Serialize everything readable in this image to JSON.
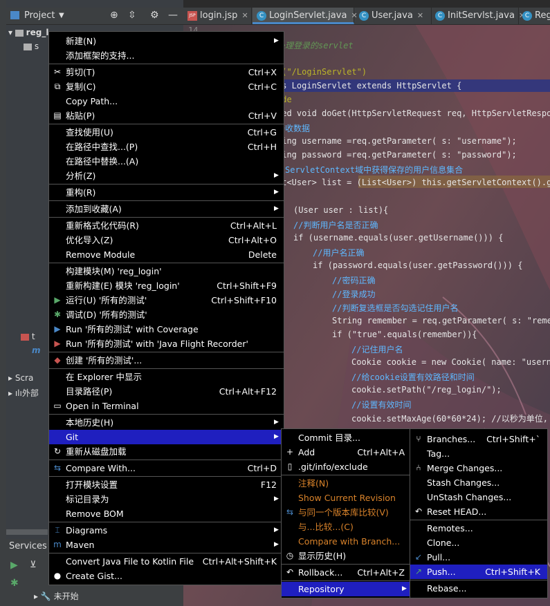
{
  "project_panel": {
    "title": "Project",
    "root_node": "reg_l",
    "tree_fragments": [
      "s",
      "t",
      "m",
      "Scra",
      "外部"
    ]
  },
  "services": {
    "label": "Services",
    "node": "未开始"
  },
  "editor": {
    "tabs": [
      {
        "label": "login.jsp",
        "icon": "jsp-file-icon"
      },
      {
        "label": "LoginServlet.java",
        "icon": "class-icon"
      },
      {
        "label": "User.java",
        "icon": "class-icon"
      },
      {
        "label": "InitServlst.java",
        "icon": "class-icon"
      },
      {
        "label": "Reg",
        "icon": "class-icon"
      }
    ],
    "line_number": "14",
    "lines": [
      {
        "t": "处理登录的servlet",
        "c": "cm"
      },
      {
        "t": "t(\"/LoginServlet\")",
        "c": "ann"
      },
      {
        "t": "ss LoginServlet extends HttpServlet {",
        "c": "plain"
      },
      {
        "t": "ide",
        "c": "ann"
      },
      {
        "t": "ted void doGet(HttpServletRequest req, HttpServletRespo",
        "c": "plain"
      },
      {
        "t": "接收数据",
        "c": "cmz"
      },
      {
        "t": "ring username =req.getParameter( s: \"username\");",
        "c": "plain"
      },
      {
        "t": "ring password =req.getParameter( s: \"password\");",
        "c": "plain"
      },
      {
        "t": "从ServletContext域中获得保存的用户信息集合",
        "c": "cmz"
      },
      {
        "t": "st<User> list = (List<User>) this.getServletContext().ge",
        "c": "plain"
      },
      {
        "t": "(User user : list){",
        "c": "plain"
      },
      {
        "t": "//判断用户名是否正确",
        "c": "cmz"
      },
      {
        "t": "if (username.equals(user.getUsername())) {",
        "c": "plain"
      },
      {
        "t": "//用户名正确",
        "c": "cmz"
      },
      {
        "t": "if (password.equals(user.getPassword())) {",
        "c": "plain"
      },
      {
        "t": "//密码正确",
        "c": "cmz"
      },
      {
        "t": "//登录成功",
        "c": "cmz"
      },
      {
        "t": "//判断复选框是否勾选记住用户名",
        "c": "cmz"
      },
      {
        "t": "String remember = req.getParameter( s: \"rememb",
        "c": "plain"
      },
      {
        "t": "if (\"true\".equals(remember)){",
        "c": "plain"
      },
      {
        "t": "//记住用户名",
        "c": "cmz"
      },
      {
        "t": "Cookie cookie = new Cookie( name: \"userna",
        "c": "plain"
      },
      {
        "t": "//给cookie设置有效路径和时间",
        "c": "cmz"
      },
      {
        "t": "cookie.setPath(\"/reg_login/\");",
        "c": "plain"
      },
      {
        "t": "//设置有效时间",
        "c": "cmz"
      },
      {
        "t": "cookie.setMaxAge(60*60*24); //以秒为单位,",
        "c": "plain"
      }
    ]
  },
  "context_menu": {
    "items": [
      {
        "label": "新建(N)",
        "shortcut": "",
        "arrow": true,
        "icon": ""
      },
      {
        "label": "添加框架的支持...",
        "shortcut": "",
        "arrow": false,
        "icon": ""
      },
      {
        "label": "剪切(T)",
        "shortcut": "Ctrl+X",
        "arrow": false,
        "icon": "scissors-icon"
      },
      {
        "label": "复制(C)",
        "shortcut": "Ctrl+C",
        "arrow": false,
        "icon": "copy-icon"
      },
      {
        "label": "Copy Path...",
        "shortcut": "",
        "arrow": false,
        "icon": ""
      },
      {
        "label": "粘贴(P)",
        "shortcut": "Ctrl+V",
        "arrow": false,
        "icon": "paste-icon"
      },
      {
        "label": "查找使用(U)",
        "shortcut": "Ctrl+G",
        "arrow": false,
        "icon": ""
      },
      {
        "label": "在路径中查找...(P)",
        "shortcut": "Ctrl+H",
        "arrow": false,
        "icon": ""
      },
      {
        "label": "在路径中替换...(A)",
        "shortcut": "",
        "arrow": false,
        "icon": ""
      },
      {
        "label": "分析(Z)",
        "shortcut": "",
        "arrow": true,
        "icon": ""
      },
      {
        "label": "重构(R)",
        "shortcut": "",
        "arrow": true,
        "icon": ""
      },
      {
        "label": "添加到收藏(A)",
        "shortcut": "",
        "arrow": true,
        "icon": ""
      },
      {
        "label": "重新格式化代码(R)",
        "shortcut": "Ctrl+Alt+L",
        "arrow": false,
        "icon": ""
      },
      {
        "label": "优化导入(Z)",
        "shortcut": "Ctrl+Alt+O",
        "arrow": false,
        "icon": ""
      },
      {
        "label": "Remove Module",
        "shortcut": "Delete",
        "arrow": false,
        "icon": ""
      },
      {
        "label": "构建模块(M) 'reg_login'",
        "shortcut": "",
        "arrow": false,
        "icon": ""
      },
      {
        "label": "重新构建(E) 模块 'reg_login'",
        "shortcut": "Ctrl+Shift+F9",
        "arrow": false,
        "icon": ""
      },
      {
        "label": "运行(U) '所有的测试'",
        "shortcut": "Ctrl+Shift+F10",
        "arrow": false,
        "icon": "run-icon"
      },
      {
        "label": "调试(D) '所有的测试'",
        "shortcut": "",
        "arrow": false,
        "icon": "debug-icon"
      },
      {
        "label": "Run '所有的测试' with Coverage",
        "shortcut": "",
        "arrow": false,
        "icon": "coverage-icon"
      },
      {
        "label": "Run '所有的测试' with 'Java Flight Recorder'",
        "shortcut": "",
        "arrow": false,
        "icon": "profiler-icon"
      },
      {
        "label": "创建 '所有的测试'...",
        "shortcut": "",
        "arrow": false,
        "icon": "create-test-icon"
      },
      {
        "label": "在 Explorer 中显示",
        "shortcut": "",
        "arrow": false,
        "icon": ""
      },
      {
        "label": "目录路径(P)",
        "shortcut": "Ctrl+Alt+F12",
        "arrow": false,
        "icon": ""
      },
      {
        "label": "Open in Terminal",
        "shortcut": "",
        "arrow": false,
        "icon": "terminal-icon"
      },
      {
        "label": "本地历史(H)",
        "shortcut": "",
        "arrow": true,
        "icon": ""
      },
      {
        "label": "Git",
        "shortcut": "",
        "arrow": true,
        "icon": ""
      },
      {
        "label": "重新从磁盘加载",
        "shortcut": "",
        "arrow": false,
        "icon": "reload-icon"
      },
      {
        "label": "Compare With...",
        "shortcut": "Ctrl+D",
        "arrow": false,
        "icon": "compare-icon"
      },
      {
        "label": "打开模块设置",
        "shortcut": "F12",
        "arrow": false,
        "icon": ""
      },
      {
        "label": "标记目录为",
        "shortcut": "",
        "arrow": true,
        "icon": ""
      },
      {
        "label": "Remove BOM",
        "shortcut": "",
        "arrow": false,
        "icon": ""
      },
      {
        "label": "Diagrams",
        "shortcut": "",
        "arrow": true,
        "icon": "diagram-icon"
      },
      {
        "label": "Maven",
        "shortcut": "",
        "arrow": true,
        "icon": "maven-icon"
      },
      {
        "label": "Convert Java File to Kotlin File",
        "shortcut": "Ctrl+Alt+Shift+K",
        "arrow": false,
        "icon": ""
      },
      {
        "label": "Create Gist...",
        "shortcut": "",
        "arrow": false,
        "icon": "github-icon"
      }
    ]
  },
  "git_menu": {
    "items": [
      {
        "label": "Commit 目录...",
        "shortcut": "",
        "icon": "",
        "disabled": false
      },
      {
        "label": "Add",
        "shortcut": "Ctrl+Alt+A",
        "icon": "plus-icon",
        "disabled": false
      },
      {
        "label": ".git/info/exclude",
        "shortcut": "",
        "icon": "git-file-icon",
        "disabled": false
      },
      {
        "label": "注释(N)",
        "shortcut": "",
        "icon": "",
        "disabled": true
      },
      {
        "label": "Show Current Revision",
        "shortcut": "",
        "icon": "",
        "disabled": true
      },
      {
        "label": "与同一个版本库比较(V)",
        "shortcut": "",
        "icon": "compare-icon",
        "disabled": true
      },
      {
        "label": "与...比较...(C)",
        "shortcut": "",
        "icon": "",
        "disabled": true
      },
      {
        "label": "Compare with Branch...",
        "shortcut": "",
        "icon": "",
        "disabled": true
      },
      {
        "label": "显示历史(H)",
        "shortcut": "",
        "icon": "history-icon",
        "disabled": false
      },
      {
        "label": "Rollback...",
        "shortcut": "Ctrl+Alt+Z",
        "icon": "rollback-icon",
        "disabled": false
      },
      {
        "label": "Repository",
        "shortcut": "",
        "icon": "",
        "disabled": false
      }
    ]
  },
  "repo_menu": {
    "items": [
      {
        "label": "Branches...",
        "shortcut": "Ctrl+Shift+`",
        "icon": "branch-icon"
      },
      {
        "label": "Tag...",
        "shortcut": "",
        "icon": ""
      },
      {
        "label": "Merge Changes...",
        "shortcut": "",
        "icon": "merge-icon"
      },
      {
        "label": "Stash Changes...",
        "shortcut": "",
        "icon": ""
      },
      {
        "label": "UnStash Changes...",
        "shortcut": "",
        "icon": ""
      },
      {
        "label": "Reset HEAD...",
        "shortcut": "",
        "icon": "reset-icon"
      },
      {
        "label": "Remotes...",
        "shortcut": "",
        "icon": ""
      },
      {
        "label": "Clone...",
        "shortcut": "",
        "icon": ""
      },
      {
        "label": "Pull...",
        "shortcut": "",
        "icon": "pull-icon"
      },
      {
        "label": "Push...",
        "shortcut": "Ctrl+Shift+K",
        "icon": "push-icon"
      },
      {
        "label": "Rebase...",
        "shortcut": "",
        "icon": ""
      }
    ]
  },
  "colors": {
    "selection": "#1f1fbf",
    "menu_bg": "#000000",
    "disabled_text": "#d8822a"
  }
}
